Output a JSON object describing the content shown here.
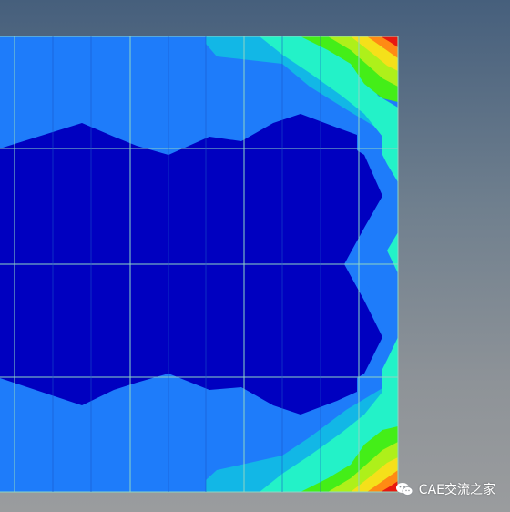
{
  "watermark": {
    "text": "CAE交流之家",
    "icon": "wechat-icon"
  },
  "colors": {
    "background_top": "#465f7c",
    "background_bottom": "#9a9c9e",
    "deep_blue": "#0000c0",
    "blue": "#1e7cfa",
    "sky": "#12b7e6",
    "cyan": "#23f2c8",
    "green": "#44ee18",
    "lime": "#aef01a",
    "yellow": "#f5e01a",
    "orange": "#ff8a14",
    "red": "#e8190f",
    "mesh_line": "#8fd6c4"
  }
}
